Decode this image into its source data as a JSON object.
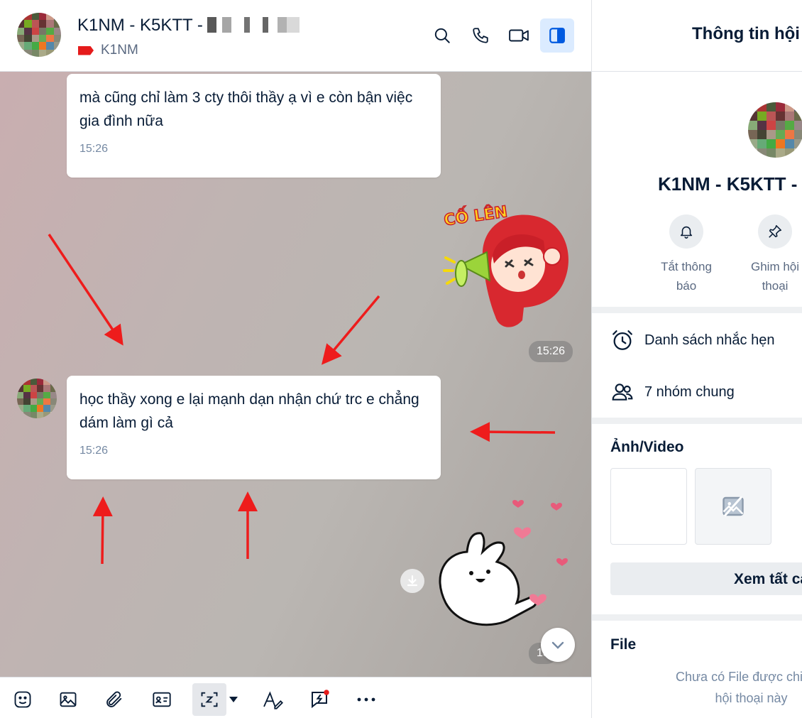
{
  "conversation": {
    "title": "K1NM - K5KTT -",
    "label": "K1NM",
    "label_color": "#e51b1b"
  },
  "header_icons": [
    "search-icon",
    "phone-icon",
    "video-call-icon",
    "sidebar-toggle-icon"
  ],
  "messages": [
    {
      "text": "mà cũng chỉ làm 3 cty thôi thầy ạ vì e còn bận việc gia đình nữa",
      "time": "15:26"
    },
    {
      "sticker": "cố lên sticker",
      "sticker_text": "CỐ LÊN",
      "time": "15:26"
    },
    {
      "text": "học thầy xong e lại mạnh dạn nhận chứ trc e chẳng dám làm gì cả",
      "time": "15:26"
    },
    {
      "sticker": "bunny sticker",
      "time": "15"
    }
  ],
  "toolbar": [
    "sticker-icon",
    "image-icon",
    "attach-icon",
    "contact-card-icon",
    "screenshot-icon",
    "format-text-icon",
    "quick-message-icon",
    "more-icon"
  ],
  "info_panel": {
    "title": "Thông tin hội thoại",
    "name": "K1NM - K5KTT - ",
    "actions": [
      {
        "label_line1": "Tắt thông",
        "label_line2": "báo",
        "icon": "bell-icon"
      },
      {
        "label_line1": "Ghim hội",
        "label_line2": "thoại",
        "icon": "pin-icon"
      }
    ],
    "reminders": "Danh sách nhắc hẹn",
    "common_groups": "7 nhóm chung",
    "media_title": "Ảnh/Video",
    "see_all": "Xem tất cả",
    "file_title": "File",
    "file_empty_line1": "Chưa có File được chia sẻ",
    "file_empty_line2": "hội thoại này"
  },
  "annotation_color": "#ee1c1c"
}
